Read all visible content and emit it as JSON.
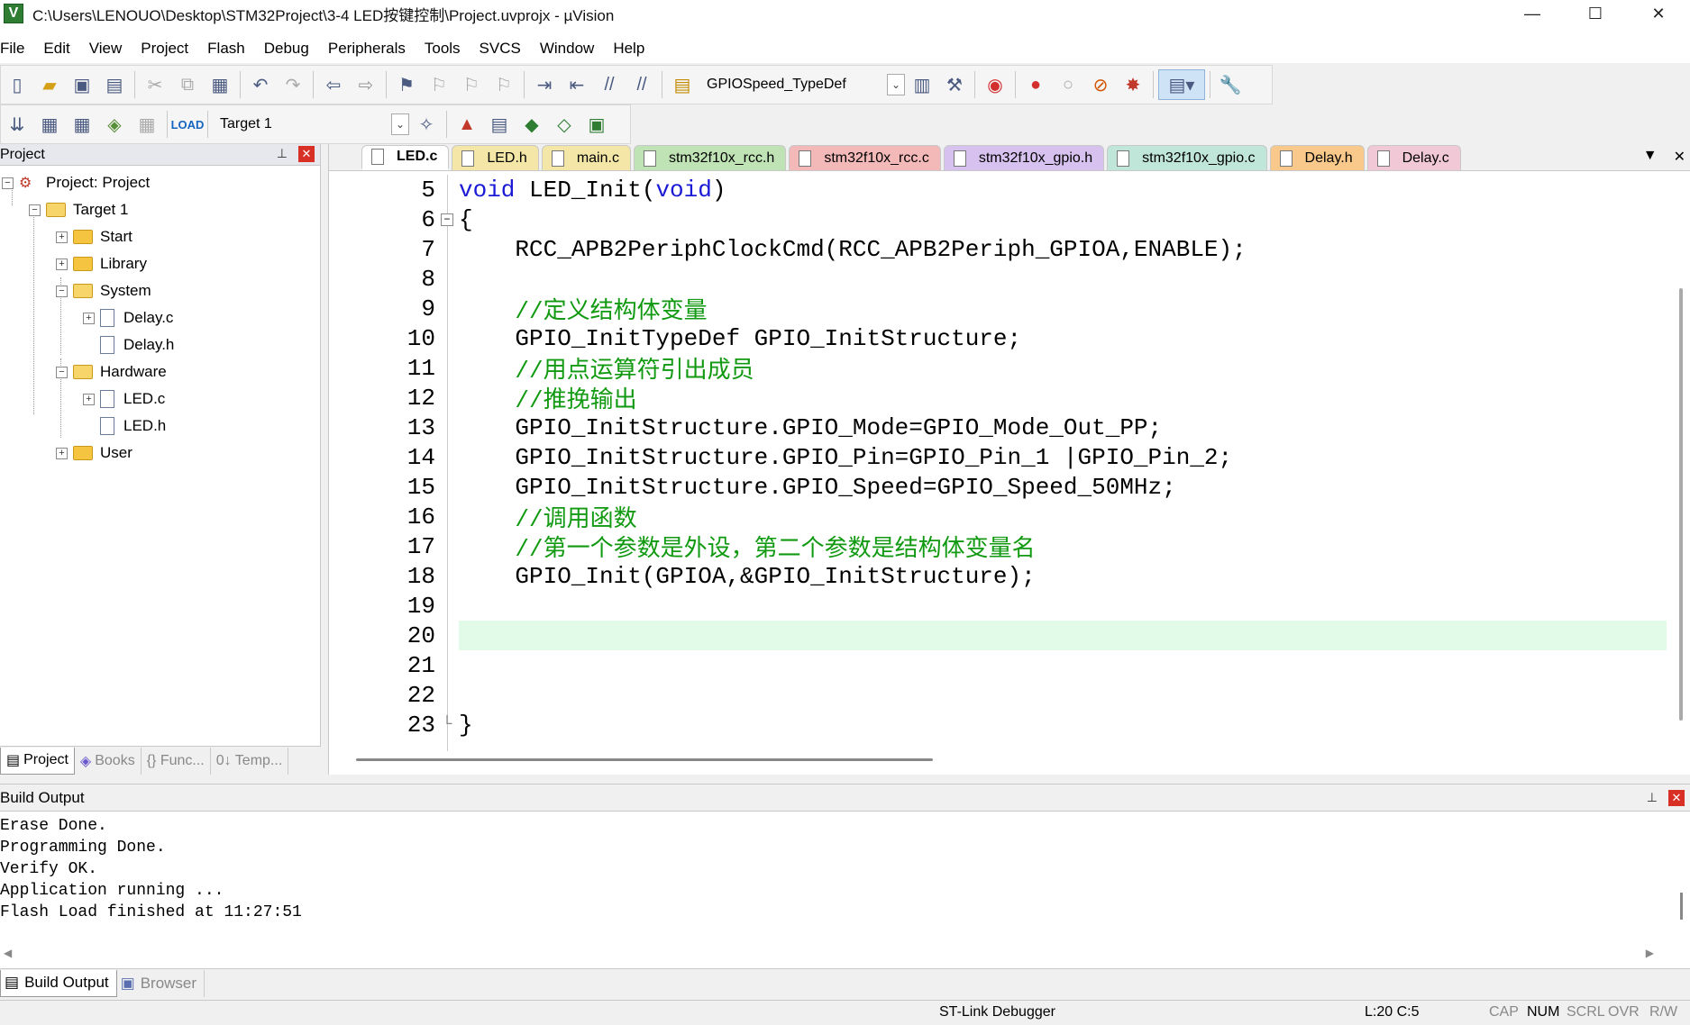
{
  "window": {
    "title": "C:\\Users\\LENOUO\\Desktop\\STM32Project\\3-4 LED按键控制\\Project.uvprojx - µVision",
    "app_icon": "uvision-icon",
    "min": "—",
    "max": "☐",
    "close": "✕"
  },
  "menu": [
    "File",
    "Edit",
    "View",
    "Project",
    "Flash",
    "Debug",
    "Peripherals",
    "Tools",
    "SVCS",
    "Window",
    "Help"
  ],
  "toolbar": {
    "find_combo": "GPIOSpeed_TypeDef",
    "target_combo": "Target 1"
  },
  "project_panel": {
    "title": "Project",
    "tree": [
      {
        "label": "Project: Project",
        "kind": "project",
        "expander": "−"
      },
      {
        "label": "Target 1",
        "kind": "target",
        "expander": "−"
      },
      {
        "label": "Start",
        "kind": "folder",
        "expander": "+"
      },
      {
        "label": "Library",
        "kind": "folder",
        "expander": "+"
      },
      {
        "label": "System",
        "kind": "folder-open",
        "expander": "−"
      },
      {
        "label": "Delay.c",
        "kind": "file",
        "expander": "+"
      },
      {
        "label": "Delay.h",
        "kind": "file",
        "expander": ""
      },
      {
        "label": "Hardware",
        "kind": "folder-open",
        "expander": "−"
      },
      {
        "label": "LED.c",
        "kind": "file",
        "expander": "+"
      },
      {
        "label": "LED.h",
        "kind": "file",
        "expander": ""
      },
      {
        "label": "User",
        "kind": "folder",
        "expander": "+"
      }
    ],
    "tabs": [
      "Project",
      "Books",
      "{} Func...",
      "0↓ Temp..."
    ]
  },
  "editor": {
    "tabs": [
      {
        "label": "LED.c",
        "color": "#ffffff",
        "active": true
      },
      {
        "label": "LED.h",
        "color": "#f3e6a6",
        "active": false
      },
      {
        "label": "main.c",
        "color": "#f3e6a6",
        "active": false
      },
      {
        "label": "stm32f10x_rcc.h",
        "color": "#bfe3b4",
        "active": false
      },
      {
        "label": "stm32f10x_rcc.c",
        "color": "#f3b8b8",
        "active": false
      },
      {
        "label": "stm32f10x_gpio.h",
        "color": "#d7c2ef",
        "active": false
      },
      {
        "label": "stm32f10x_gpio.c",
        "color": "#bfe6d9",
        "active": false
      },
      {
        "label": "Delay.h",
        "color": "#f8c98a",
        "active": false
      },
      {
        "label": "Delay.c",
        "color": "#f1c8d6",
        "active": false
      }
    ],
    "tab_menu_icon": "▼",
    "tab_close_icon": "✕",
    "lines": [
      {
        "n": "5",
        "code": "void LED_Init(void)",
        "type": "decl",
        "fold": ""
      },
      {
        "n": "6",
        "code": "{",
        "type": "plain",
        "fold": "−"
      },
      {
        "n": "7",
        "code": "    RCC_APB2PeriphClockCmd(RCC_APB2Periph_GPIOA,ENABLE);",
        "type": "plain",
        "fold": ""
      },
      {
        "n": "8",
        "code": "",
        "type": "plain",
        "fold": ""
      },
      {
        "n": "9",
        "code": "    //定义结构体变量",
        "type": "comment",
        "fold": ""
      },
      {
        "n": "10",
        "code": "    GPIO_InitTypeDef GPIO_InitStructure;",
        "type": "plain",
        "fold": ""
      },
      {
        "n": "11",
        "code": "    //用点运算符引出成员",
        "type": "comment",
        "fold": ""
      },
      {
        "n": "12",
        "code": "    //推挽输出",
        "type": "comment",
        "fold": ""
      },
      {
        "n": "13",
        "code": "    GPIO_InitStructure.GPIO_Mode=GPIO_Mode_Out_PP;",
        "type": "plain",
        "fold": ""
      },
      {
        "n": "14",
        "code": "    GPIO_InitStructure.GPIO_Pin=GPIO_Pin_1 |GPIO_Pin_2;",
        "type": "plain",
        "fold": ""
      },
      {
        "n": "15",
        "code": "    GPIO_InitStructure.GPIO_Speed=GPIO_Speed_50MHz;",
        "type": "plain",
        "fold": ""
      },
      {
        "n": "16",
        "code": "    //调用函数",
        "type": "comment",
        "fold": ""
      },
      {
        "n": "17",
        "code": "    //第一个参数是外设，第二个参数是结构体变量名",
        "type": "comment",
        "fold": ""
      },
      {
        "n": "18",
        "code": "    GPIO_Init(GPIOA,&GPIO_InitStructure);",
        "type": "plain",
        "fold": ""
      },
      {
        "n": "19",
        "code": "",
        "type": "plain",
        "fold": ""
      },
      {
        "n": "20",
        "code": "",
        "type": "current",
        "fold": ""
      },
      {
        "n": "21",
        "code": "",
        "type": "plain",
        "fold": ""
      },
      {
        "n": "22",
        "code": "",
        "type": "plain",
        "fold": ""
      },
      {
        "n": "23",
        "code": "}",
        "type": "plain",
        "fold": "└"
      }
    ]
  },
  "build_output": {
    "title": "Build Output",
    "lines": [
      "Erase Done.",
      "Programming Done.",
      "Verify OK.",
      "Application running ...",
      "Flash Load finished at 11:27:51"
    ],
    "tabs": [
      "Build Output",
      "Browser"
    ]
  },
  "status": {
    "debugger": "ST-Link Debugger",
    "position": "L:20 C:5",
    "caps": "CAP",
    "num": "NUM",
    "scrl": "SCRL",
    "ovr": "OVR",
    "rw": "R/W"
  },
  "colors": {
    "keyword": "#1a1ad6",
    "comment": "#119a11",
    "current_line": "#e2fbe8",
    "close_red": "#d93025"
  }
}
